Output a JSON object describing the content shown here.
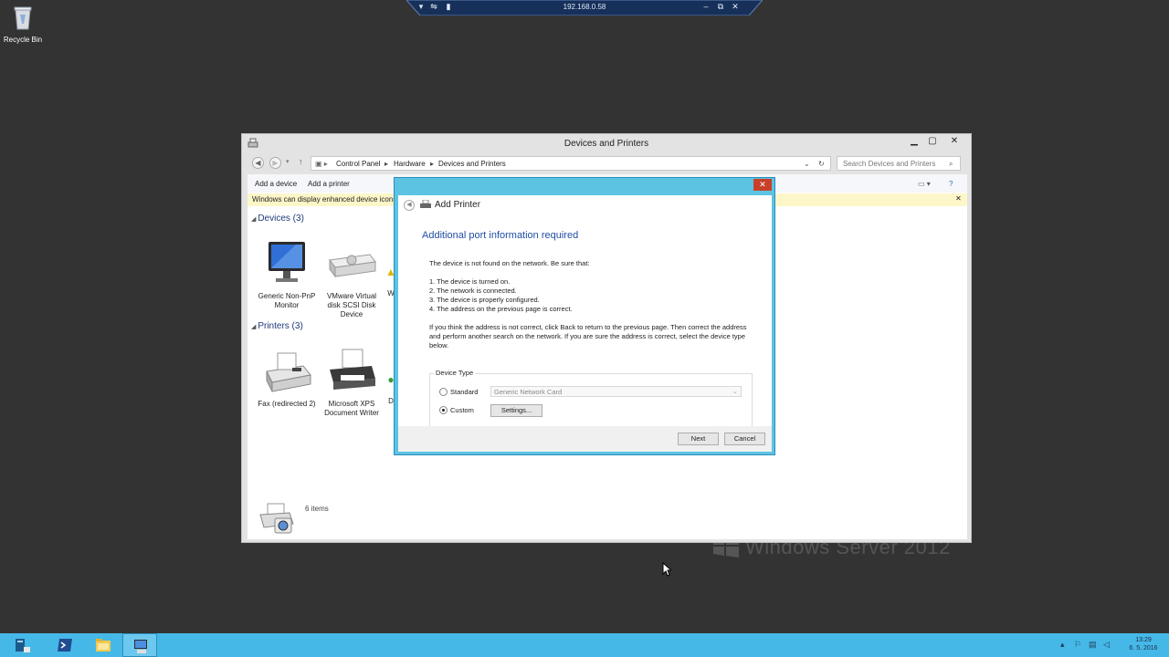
{
  "desktop": {
    "recycle_bin_label": "Recycle Bin",
    "watermark": "Windows Server 2012"
  },
  "rdp_bar": {
    "host": "192.168.0.58"
  },
  "explorer": {
    "title": "Devices and Printers",
    "breadcrumb": [
      "Control Panel",
      "Hardware",
      "Devices and Printers"
    ],
    "search_placeholder": "Search Devices and Printers",
    "commands": [
      "Add a device",
      "Add a printer"
    ],
    "infobar_text": "Windows can display enhanced device icons",
    "groups": {
      "devices": {
        "header": "Devices (3)",
        "items": [
          "Generic Non-PnP Monitor",
          "VMware Virtual disk SCSI Disk Device",
          "W"
        ]
      },
      "printers": {
        "header": "Printers (3)",
        "items": [
          "Fax (redirected 2)",
          "Microsoft XPS Document Writer",
          "D"
        ]
      }
    },
    "details_count": "6 items"
  },
  "dialog": {
    "title": "Add Printer",
    "heading": "Additional port information required",
    "intro": "The device is not found on the network.  Be sure that:",
    "checklist": [
      "1.  The device is turned on.",
      "2.  The network is connected.",
      "3.  The device is properly configured.",
      "4.  The address on the previous page is correct."
    ],
    "paragraph": "If you think the address is not correct, click Back to return to the previous page.  Then correct the address and perform another search on the network.  If you are sure the address is correct, select the device type below.",
    "device_type": {
      "legend": "Device Type",
      "standard_label": "Standard",
      "standard_value": "Generic Network Card",
      "custom_label": "Custom",
      "selected": "Custom",
      "settings_button": "Settings..."
    },
    "next_button": "Next",
    "cancel_button": "Cancel"
  },
  "taskbar": {
    "clock_time": "13:29",
    "clock_date": "6. 5. 2016"
  },
  "colors": {
    "desktop": "#333333",
    "taskbar": "#46b8e8",
    "dialog_frame": "#5cc3e3",
    "heading_blue": "#1f4ea6",
    "close_red": "#c7402a"
  }
}
